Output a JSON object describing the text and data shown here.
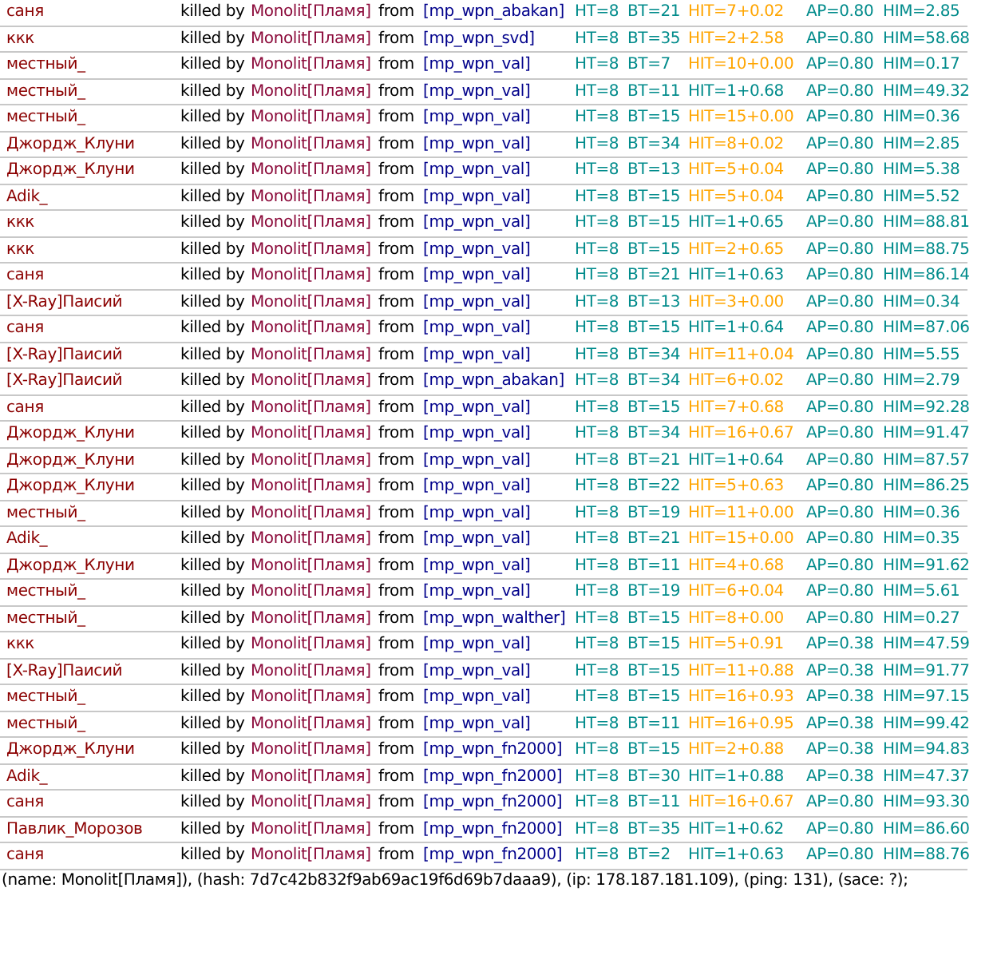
{
  "rows": [
    {
      "victim": "саня",
      "verb": "killed by",
      "killer": "Monolit[Пламя]",
      "preposition": "from",
      "weapon": "[mp_wpn_abakan]",
      "ht": "HT=8",
      "bt": "BT=21",
      "hit": "HIT=7+0.02",
      "hit_highlight": true,
      "ap": "AP=0.80",
      "him": "HIM=2.85"
    },
    {
      "victim": "ккк",
      "verb": "killed by",
      "killer": "Monolit[Пламя]",
      "preposition": "from",
      "weapon": "[mp_wpn_svd]",
      "ht": "HT=8",
      "bt": "BT=35",
      "hit": "HIT=2+2.58",
      "hit_highlight": true,
      "ap": "AP=0.80",
      "him": "HIM=58.68"
    },
    {
      "victim": "местный_",
      "verb": "killed by",
      "killer": "Monolit[Пламя]",
      "preposition": "from",
      "weapon": "[mp_wpn_val]",
      "ht": "HT=8",
      "bt": "BT=7",
      "hit": "HIT=10+0.00",
      "hit_highlight": true,
      "ap": "AP=0.80",
      "him": "HIM=0.17"
    },
    {
      "victim": "местный_",
      "verb": "killed by",
      "killer": "Monolit[Пламя]",
      "preposition": "from",
      "weapon": "[mp_wpn_val]",
      "ht": "HT=8",
      "bt": "BT=11",
      "hit": "HIT=1+0.68",
      "hit_highlight": false,
      "ap": "AP=0.80",
      "him": "HIM=49.32"
    },
    {
      "victim": "местный_",
      "verb": "killed by",
      "killer": "Monolit[Пламя]",
      "preposition": "from",
      "weapon": "[mp_wpn_val]",
      "ht": "HT=8",
      "bt": "BT=15",
      "hit": "HIT=15+0.00",
      "hit_highlight": true,
      "ap": "AP=0.80",
      "him": "HIM=0.36"
    },
    {
      "victim": "Джордж_Клуни",
      "verb": "killed by",
      "killer": "Monolit[Пламя]",
      "preposition": "from",
      "weapon": "[mp_wpn_val]",
      "ht": "HT=8",
      "bt": "BT=34",
      "hit": "HIT=8+0.02",
      "hit_highlight": true,
      "ap": "AP=0.80",
      "him": "HIM=2.85"
    },
    {
      "victim": "Джордж_Клуни",
      "verb": "killed by",
      "killer": "Monolit[Пламя]",
      "preposition": "from",
      "weapon": "[mp_wpn_val]",
      "ht": "HT=8",
      "bt": "BT=13",
      "hit": "HIT=5+0.04",
      "hit_highlight": true,
      "ap": "AP=0.80",
      "him": "HIM=5.38"
    },
    {
      "victim": "Adik_",
      "verb": "killed by",
      "killer": "Monolit[Пламя]",
      "preposition": "from",
      "weapon": "[mp_wpn_val]",
      "ht": "HT=8",
      "bt": "BT=15",
      "hit": "HIT=5+0.04",
      "hit_highlight": true,
      "ap": "AP=0.80",
      "him": "HIM=5.52"
    },
    {
      "victim": "ккк",
      "verb": "killed by",
      "killer": "Monolit[Пламя]",
      "preposition": "from",
      "weapon": "[mp_wpn_val]",
      "ht": "HT=8",
      "bt": "BT=15",
      "hit": "HIT=1+0.65",
      "hit_highlight": false,
      "ap": "AP=0.80",
      "him": "HIM=88.81"
    },
    {
      "victim": "ккк",
      "verb": "killed by",
      "killer": "Monolit[Пламя]",
      "preposition": "from",
      "weapon": "[mp_wpn_val]",
      "ht": "HT=8",
      "bt": "BT=15",
      "hit": "HIT=2+0.65",
      "hit_highlight": true,
      "ap": "AP=0.80",
      "him": "HIM=88.75"
    },
    {
      "victim": "саня",
      "verb": "killed by",
      "killer": "Monolit[Пламя]",
      "preposition": "from",
      "weapon": "[mp_wpn_val]",
      "ht": "HT=8",
      "bt": "BT=21",
      "hit": "HIT=1+0.63",
      "hit_highlight": false,
      "ap": "AP=0.80",
      "him": "HIM=86.14"
    },
    {
      "victim": "[X-Ray]Паисий",
      "verb": "killed by",
      "killer": "Monolit[Пламя]",
      "preposition": "from",
      "weapon": "[mp_wpn_val]",
      "ht": "HT=8",
      "bt": "BT=13",
      "hit": "HIT=3+0.00",
      "hit_highlight": true,
      "ap": "AP=0.80",
      "him": "HIM=0.34"
    },
    {
      "victim": "саня",
      "verb": "killed by",
      "killer": "Monolit[Пламя]",
      "preposition": "from",
      "weapon": "[mp_wpn_val]",
      "ht": "HT=8",
      "bt": "BT=15",
      "hit": "HIT=1+0.64",
      "hit_highlight": false,
      "ap": "AP=0.80",
      "him": "HIM=87.06"
    },
    {
      "victim": "[X-Ray]Паисий",
      "verb": "killed by",
      "killer": "Monolit[Пламя]",
      "preposition": "from",
      "weapon": "[mp_wpn_val]",
      "ht": "HT=8",
      "bt": "BT=34",
      "hit": "HIT=11+0.04",
      "hit_highlight": true,
      "ap": "AP=0.80",
      "him": "HIM=5.55"
    },
    {
      "victim": "[X-Ray]Паисий",
      "verb": "killed by",
      "killer": "Monolit[Пламя]",
      "preposition": "from",
      "weapon": "[mp_wpn_abakan]",
      "ht": "HT=8",
      "bt": "BT=34",
      "hit": "HIT=6+0.02",
      "hit_highlight": true,
      "ap": "AP=0.80",
      "him": "HIM=2.79"
    },
    {
      "victim": "саня",
      "verb": "killed by",
      "killer": "Monolit[Пламя]",
      "preposition": "from",
      "weapon": "[mp_wpn_val]",
      "ht": "HT=8",
      "bt": "BT=15",
      "hit": "HIT=7+0.68",
      "hit_highlight": true,
      "ap": "AP=0.80",
      "him": "HIM=92.28"
    },
    {
      "victim": "Джордж_Клуни",
      "verb": "killed by",
      "killer": "Monolit[Пламя]",
      "preposition": "from",
      "weapon": "[mp_wpn_val]",
      "ht": "HT=8",
      "bt": "BT=34",
      "hit": "HIT=16+0.67",
      "hit_highlight": true,
      "ap": "AP=0.80",
      "him": "HIM=91.47"
    },
    {
      "victim": "Джордж_Клуни",
      "verb": "killed by",
      "killer": "Monolit[Пламя]",
      "preposition": "from",
      "weapon": "[mp_wpn_val]",
      "ht": "HT=8",
      "bt": "BT=21",
      "hit": "HIT=1+0.64",
      "hit_highlight": false,
      "ap": "AP=0.80",
      "him": "HIM=87.57"
    },
    {
      "victim": "Джордж_Клуни",
      "verb": "killed by",
      "killer": "Monolit[Пламя]",
      "preposition": "from",
      "weapon": "[mp_wpn_val]",
      "ht": "HT=8",
      "bt": "BT=22",
      "hit": "HIT=5+0.63",
      "hit_highlight": true,
      "ap": "AP=0.80",
      "him": "HIM=86.25"
    },
    {
      "victim": "местный_",
      "verb": "killed by",
      "killer": "Monolit[Пламя]",
      "preposition": "from",
      "weapon": "[mp_wpn_val]",
      "ht": "HT=8",
      "bt": "BT=19",
      "hit": "HIT=11+0.00",
      "hit_highlight": true,
      "ap": "AP=0.80",
      "him": "HIM=0.36"
    },
    {
      "victim": "Adik_",
      "verb": "killed by",
      "killer": "Monolit[Пламя]",
      "preposition": "from",
      "weapon": "[mp_wpn_val]",
      "ht": "HT=8",
      "bt": "BT=21",
      "hit": "HIT=15+0.00",
      "hit_highlight": true,
      "ap": "AP=0.80",
      "him": "HIM=0.35"
    },
    {
      "victim": "Джордж_Клуни",
      "verb": "killed by",
      "killer": "Monolit[Пламя]",
      "preposition": "from",
      "weapon": "[mp_wpn_val]",
      "ht": "HT=8",
      "bt": "BT=11",
      "hit": "HIT=4+0.68",
      "hit_highlight": true,
      "ap": "AP=0.80",
      "him": "HIM=91.62"
    },
    {
      "victim": "местный_",
      "verb": "killed by",
      "killer": "Monolit[Пламя]",
      "preposition": "from",
      "weapon": "[mp_wpn_val]",
      "ht": "HT=8",
      "bt": "BT=19",
      "hit": "HIT=6+0.04",
      "hit_highlight": true,
      "ap": "AP=0.80",
      "him": "HIM=5.61"
    },
    {
      "victim": "местный_",
      "verb": "killed by",
      "killer": "Monolit[Пламя]",
      "preposition": "from",
      "weapon": "[mp_wpn_walther]",
      "ht": "HT=8",
      "bt": "BT=15",
      "hit": "HIT=8+0.00",
      "hit_highlight": true,
      "ap": "AP=0.80",
      "him": "HIM=0.27"
    },
    {
      "victim": "ккк",
      "verb": "killed by",
      "killer": "Monolit[Пламя]",
      "preposition": "from",
      "weapon": "[mp_wpn_val]",
      "ht": "HT=8",
      "bt": "BT=15",
      "hit": "HIT=5+0.91",
      "hit_highlight": true,
      "ap": "AP=0.38",
      "him": "HIM=47.59"
    },
    {
      "victim": "[X-Ray]Паисий",
      "verb": "killed by",
      "killer": "Monolit[Пламя]",
      "preposition": "from",
      "weapon": "[mp_wpn_val]",
      "ht": "HT=8",
      "bt": "BT=15",
      "hit": "HIT=11+0.88",
      "hit_highlight": true,
      "ap": "AP=0.38",
      "him": "HIM=91.77"
    },
    {
      "victim": "местный_",
      "verb": "killed by",
      "killer": "Monolit[Пламя]",
      "preposition": "from",
      "weapon": "[mp_wpn_val]",
      "ht": "HT=8",
      "bt": "BT=15",
      "hit": "HIT=16+0.93",
      "hit_highlight": true,
      "ap": "AP=0.38",
      "him": "HIM=97.15"
    },
    {
      "victim": "местный_",
      "verb": "killed by",
      "killer": "Monolit[Пламя]",
      "preposition": "from",
      "weapon": "[mp_wpn_val]",
      "ht": "HT=8",
      "bt": "BT=11",
      "hit": "HIT=16+0.95",
      "hit_highlight": true,
      "ap": "AP=0.38",
      "him": "HIM=99.42"
    },
    {
      "victim": "Джордж_Клуни",
      "verb": "killed by",
      "killer": "Monolit[Пламя]",
      "preposition": "from",
      "weapon": "[mp_wpn_fn2000]",
      "ht": "HT=8",
      "bt": "BT=15",
      "hit": "HIT=2+0.88",
      "hit_highlight": true,
      "ap": "AP=0.38",
      "him": "HIM=94.83"
    },
    {
      "victim": "Adik_",
      "verb": "killed by",
      "killer": "Monolit[Пламя]",
      "preposition": "from",
      "weapon": "[mp_wpn_fn2000]",
      "ht": "HT=8",
      "bt": "BT=30",
      "hit": "HIT=1+0.88",
      "hit_highlight": false,
      "ap": "AP=0.38",
      "him": "HIM=47.37"
    },
    {
      "victim": "саня",
      "verb": "killed by",
      "killer": "Monolit[Пламя]",
      "preposition": "from",
      "weapon": "[mp_wpn_fn2000]",
      "ht": "HT=8",
      "bt": "BT=11",
      "hit": "HIT=16+0.67",
      "hit_highlight": true,
      "ap": "AP=0.80",
      "him": "HIM=93.30"
    },
    {
      "victim": "Павлик_Морозов",
      "verb": "killed by",
      "killer": "Monolit[Пламя]",
      "preposition": "from",
      "weapon": "[mp_wpn_fn2000]",
      "ht": "HT=8",
      "bt": "BT=35",
      "hit": "HIT=1+0.62",
      "hit_highlight": false,
      "ap": "AP=0.80",
      "him": "HIM=86.60"
    },
    {
      "victim": "саня",
      "verb": "killed by",
      "killer": "Monolit[Пламя]",
      "preposition": "from",
      "weapon": "[mp_wpn_fn2000]",
      "ht": "HT=8",
      "bt": "BT=2",
      "hit": "HIT=1+0.63",
      "hit_highlight": false,
      "ap": "AP=0.80",
      "him": "HIM=88.76"
    }
  ],
  "footer": "(name: Monolit[Пламя]), (hash: 7d7c42b832f9ab69ac19f6d69b7daaa9), (ip: 178.187.181.109), (ping: 131), (sace: ?);"
}
